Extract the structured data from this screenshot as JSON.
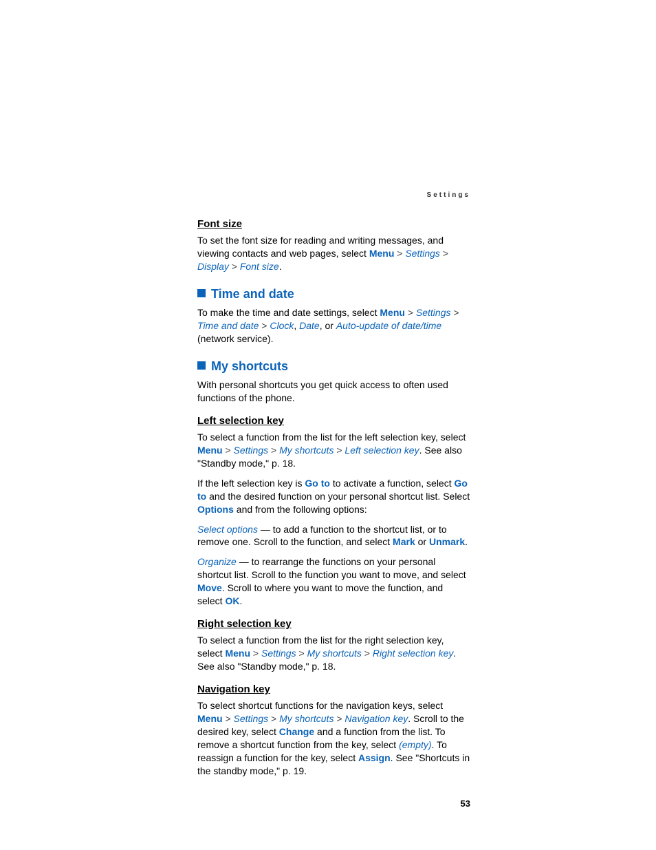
{
  "header": {
    "section": "Settings"
  },
  "fontsize": {
    "title": "Font size",
    "p1a": "To set the font size for reading and writing messages, and viewing contacts and web pages, select ",
    "menu": "Menu",
    "settings": "Settings",
    "display": "Display",
    "fontsize": "Font size",
    "period": "."
  },
  "timedate": {
    "title": "Time and date",
    "p1a": "To make the time and date settings, select ",
    "menu": "Menu",
    "settings": "Settings",
    "timeanddate": "Time and date",
    "clock": "Clock",
    "date": "Date",
    "auto": "Auto-update of date/time",
    "tail": " (network service).",
    "comma": ", ",
    "or": ", or "
  },
  "myshortcuts": {
    "title": "My shortcuts",
    "intro": "With personal shortcuts you get quick access to often used functions of the phone."
  },
  "leftkey": {
    "title": "Left selection key",
    "p1a": "To select a function from the list for the left selection key, select ",
    "menu": "Menu",
    "settings": "Settings",
    "myshortcuts": "My shortcuts",
    "leftselkey": "Left selection key",
    "p1b": ". See also \"Standby mode,\" p. 18.",
    "p2a": "If the left selection key is ",
    "goto1": "Go to",
    "p2b": " to activate a function, select ",
    "goto2": "Go to",
    "p2c": " and the desired function on your personal shortcut list. Select ",
    "options": "Options",
    "p2d": " and from the following options:",
    "selopt": "Select options",
    "p3b": " — to add a function to the shortcut list, or to remove one. Scroll to the function, and select ",
    "mark": "Mark",
    "or": " or ",
    "unmark": "Unmark",
    "period": ".",
    "organize": "Organize",
    "p4b": " — to rearrange the functions on your personal shortcut list. Scroll to the function you want to move, and select ",
    "move": "Move",
    "p4c": ". Scroll to where you want to move the function, and select ",
    "ok": "OK"
  },
  "rightkey": {
    "title": "Right selection key",
    "p1a": "To select a function from the list for the right selection key, select ",
    "menu": "Menu",
    "settings": "Settings",
    "myshortcuts": "My shortcuts",
    "rightselkey": "Right selection key",
    "p1b": ". See also \"Standby mode,\" p. 18."
  },
  "navkey": {
    "title": "Navigation key",
    "p1a": "To select shortcut functions for the navigation keys, select ",
    "menu": "Menu",
    "settings": "Settings",
    "myshortcuts": "My shortcuts",
    "navkey": "Navigation key",
    "p1b": ". Scroll to the desired key, select ",
    "change": "Change",
    "p1c": " and a function from the list. To remove a shortcut function from the key, select ",
    "empty": "(empty)",
    "p1d": ". To reassign a function for the key, select ",
    "assign": "Assign",
    "p1e": ". See \"Shortcuts in the standby mode,\" p. 19."
  },
  "gt": " > ",
  "pagenum": "53"
}
